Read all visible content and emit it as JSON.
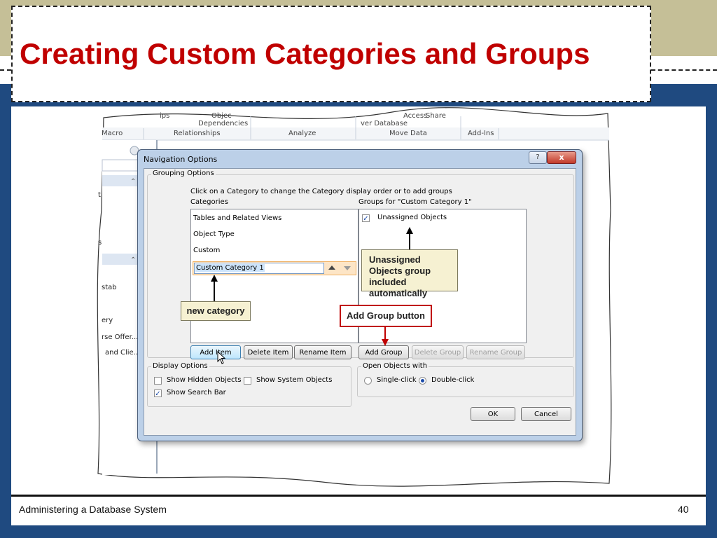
{
  "slide": {
    "title": "Creating Custom Categories and Groups",
    "footer_left": "Administering a Database System",
    "page_number": "40"
  },
  "ribbon": {
    "top_fragments": [
      "ips",
      "Objec",
      "Dependencies",
      "Access",
      "Share",
      "ver Database"
    ],
    "groups": [
      "Macro",
      "Relationships",
      "Analyze",
      "Move Data",
      "Add-Ins"
    ]
  },
  "left_pane": {
    "items": [
      "t",
      "s",
      "stab",
      "ery",
      "rse Offer...",
      "and Clie..."
    ]
  },
  "dialog": {
    "title": "Navigation Options",
    "help_label": "?",
    "close_label": "x",
    "grouping_options_label": "Grouping Options",
    "instruction": "Click on a Category to change the Category display order or to add groups",
    "categories_label": "Categories",
    "groups_label": "Groups for \"Custom Category 1\"",
    "categories": [
      "Tables and Related Views",
      "Object Type",
      "Custom"
    ],
    "edit_category_value": "Custom Category 1",
    "groups": [
      {
        "label": "Unassigned Objects",
        "checked": "✓"
      }
    ],
    "buttons": {
      "add_item": "Add Item",
      "delete_item": "Delete Item",
      "rename_item": "Rename Item",
      "add_group": "Add Group",
      "delete_group": "Delete Group",
      "rename_group": "Rename Group",
      "ok": "OK",
      "cancel": "Cancel"
    },
    "display_options_label": "Display Options",
    "show_hidden_objects": "Show Hidden Objects",
    "show_system_objects": "Show System Objects",
    "show_search_bar": "Show Search Bar",
    "show_search_bar_checked": "✓",
    "open_objects_label": "Open Objects with",
    "single_click": "Single-click",
    "double_click": "Double-click"
  },
  "callouts": {
    "new_category": "new category",
    "unassigned": "Unassigned Objects group included automatically",
    "add_group_button": "Add Group button"
  },
  "colors": {
    "title_red": "#c00000",
    "frame_blue": "#1f4a80",
    "band_tan": "#c5bf97",
    "callout_fill": "#f6f1d2"
  }
}
